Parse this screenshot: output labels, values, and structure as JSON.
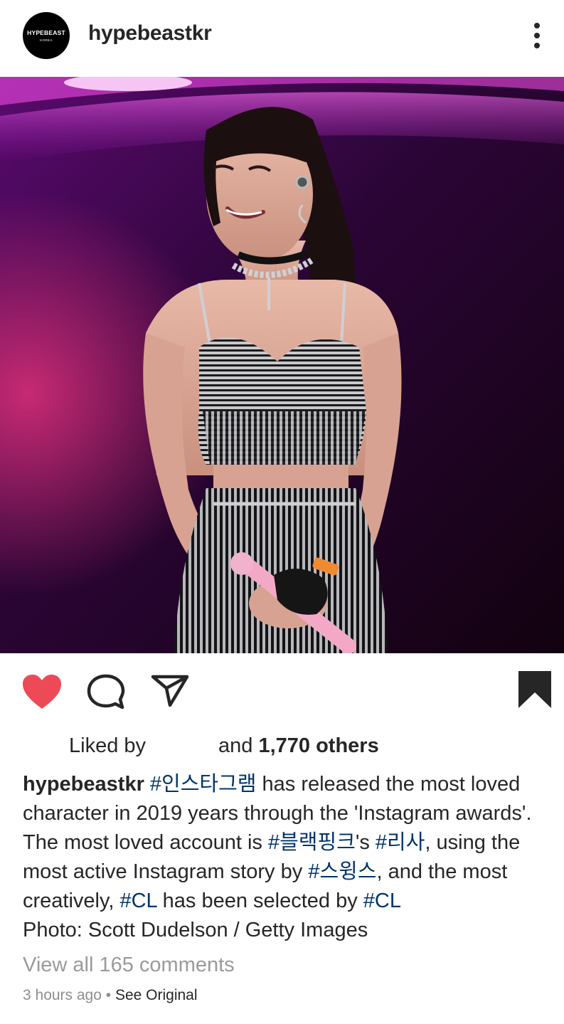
{
  "post": {
    "avatar_text_1": "HYPEBEAST",
    "avatar_text_2": "KOREA",
    "username": "hypebeastkr",
    "liked_by_label": "Liked by",
    "likes_and": "and",
    "likes_count": "1,770 others",
    "caption": {
      "username": "hypebeastkr",
      "segments": [
        {
          "text": " ",
          "tag": false
        },
        {
          "text": "#인스타그램",
          "tag": true
        },
        {
          "text": " has released the most loved character in 2019 years through the 'Instagram awards'. The most loved account is ",
          "tag": false
        },
        {
          "text": "#블랙핑크",
          "tag": true
        },
        {
          "text": "'s ",
          "tag": false
        },
        {
          "text": "#리사",
          "tag": true
        },
        {
          "text": ", using the most active Instagram story by ",
          "tag": false
        },
        {
          "text": "#스윙스",
          "tag": true
        },
        {
          "text": ", and the most creatively, ",
          "tag": false
        },
        {
          "text": "#CL",
          "tag": true
        },
        {
          "text": " has been selected by ",
          "tag": false
        },
        {
          "text": "#CL",
          "tag": true
        }
      ],
      "credit": "Photo: Scott Dudelson / Getty Images"
    },
    "view_comments": "View all 165 comments",
    "time_ago": "3 hours ago",
    "separator": "•",
    "see_original": "See Original"
  },
  "icons": {
    "like": "heart-icon",
    "comment": "comment-icon",
    "share": "send-icon",
    "save": "bookmark-icon",
    "more": "more-vertical-icon"
  },
  "colors": {
    "liked_heart": "#ed4956",
    "hashtag": "#003569",
    "text": "#262626",
    "muted": "#8e8e8e"
  }
}
